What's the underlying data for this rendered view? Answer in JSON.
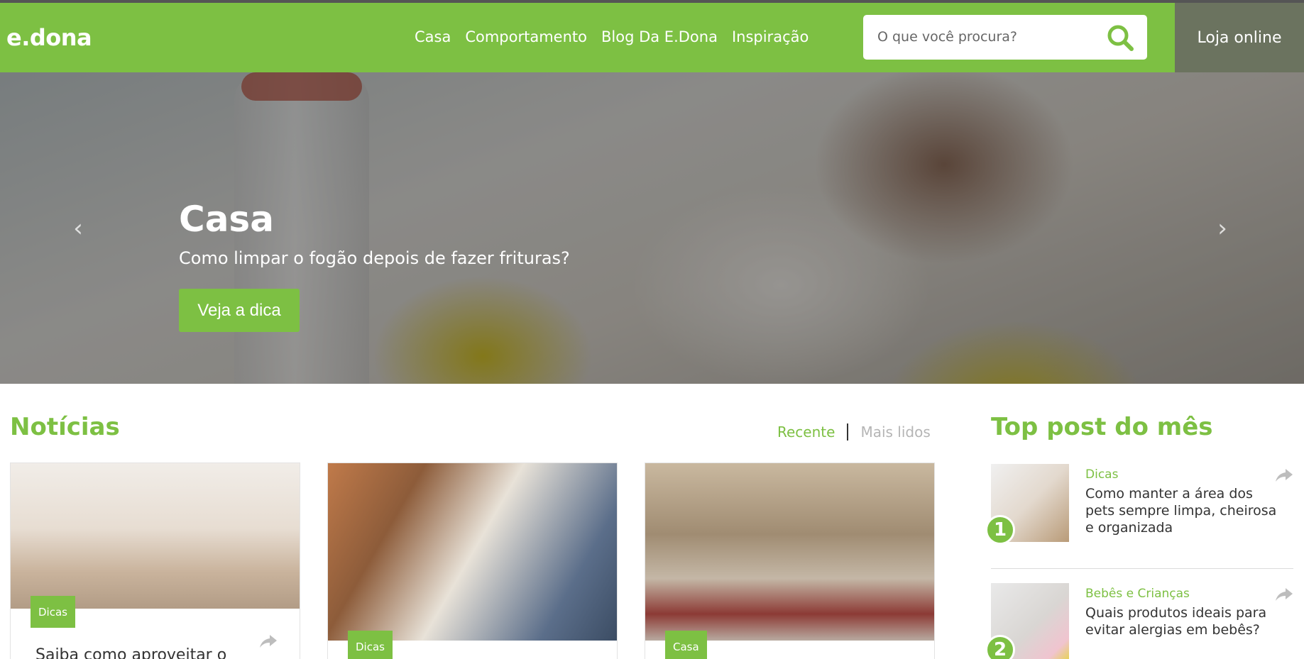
{
  "header": {
    "logo": "e.dona",
    "nav": [
      "Casa",
      "Comportamento",
      "Blog Da E.Dona",
      "Inspiração"
    ],
    "search_placeholder": "O que você procura?",
    "store_label": "Loja online"
  },
  "hero": {
    "category": "Casa",
    "subtitle": "Como limpar o fogão depois de fazer frituras?",
    "button_label": "Veja a dica",
    "prev_arrow": "‹",
    "next_arrow": "›"
  },
  "news": {
    "title": "Notícias",
    "tabs": {
      "recent": "Recente",
      "most_read": "Mais lidos"
    },
    "cards": [
      {
        "category": "Dicas",
        "title": "Saiba como aproveitar o"
      },
      {
        "category": "Dicas",
        "title": ""
      },
      {
        "category": "Casa",
        "title": ""
      }
    ]
  },
  "top_posts": {
    "title": "Top post do mês",
    "items": [
      {
        "rank": "1",
        "category": "Dicas",
        "title": "Como manter a área dos pets sempre limpa, cheirosa e organizada"
      },
      {
        "rank": "2",
        "category": "Bebês e Crianças",
        "title": "Quais produtos ideais para evitar alergias em bebês?"
      }
    ]
  },
  "colors": {
    "brand_green": "#7dc043",
    "store_button": "#6b735f",
    "muted_tab": "#b5b5b5"
  },
  "icons": [
    "search-icon",
    "share-icon",
    "chevron-left-icon",
    "chevron-right-icon"
  ]
}
